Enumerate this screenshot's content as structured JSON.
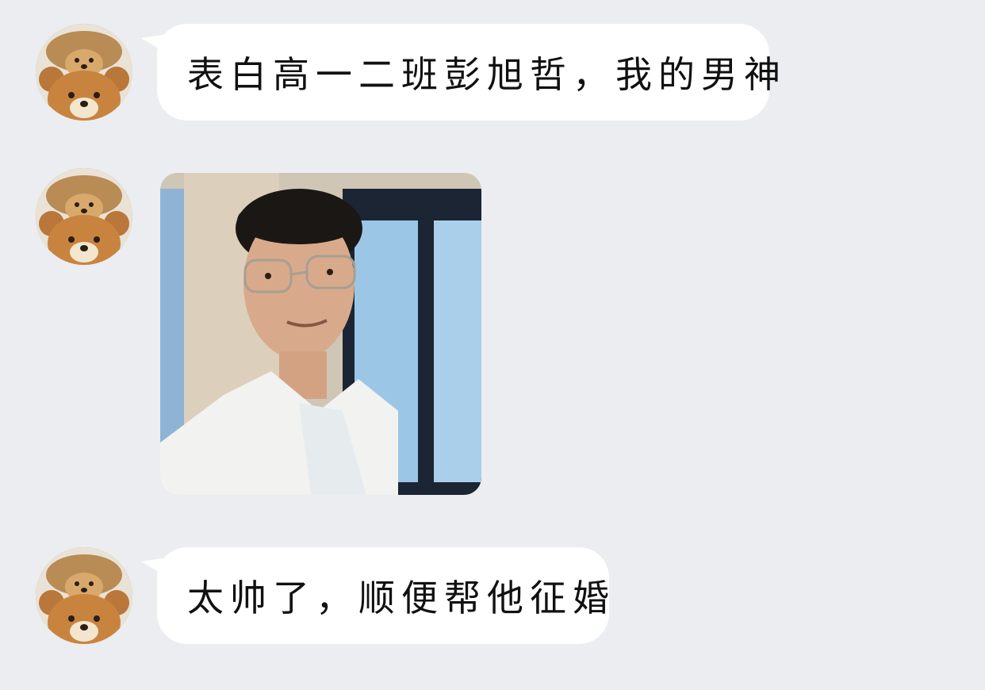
{
  "messages": [
    {
      "type": "text",
      "sender": "bear-avatar",
      "text": "表白高一二班彭旭哲，我的男神"
    },
    {
      "type": "image",
      "sender": "bear-avatar",
      "image_subject": "photo of a young man with glasses in a white shirt"
    },
    {
      "type": "text",
      "sender": "bear-avatar",
      "text": "太帅了，顺便帮他征婚"
    }
  ],
  "colors": {
    "background": "#EBEDF1",
    "bubble": "#FFFFFF",
    "text": "#111111"
  }
}
